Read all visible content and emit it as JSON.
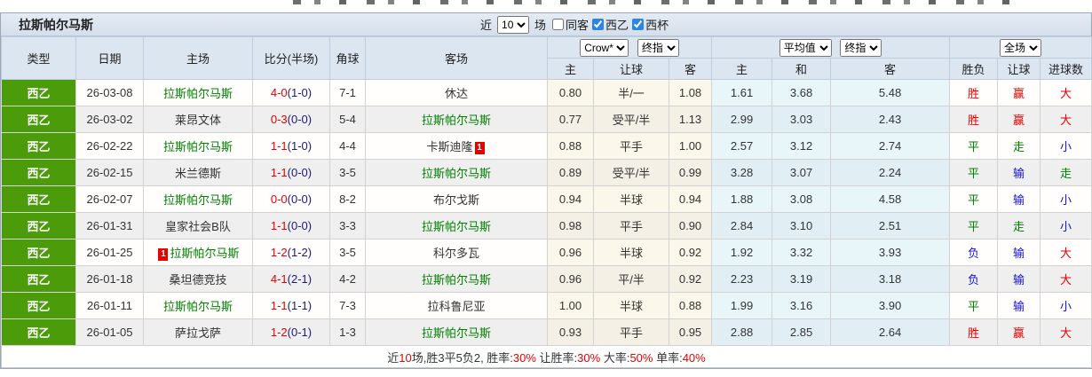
{
  "widget": {
    "title": "拉斯帕尔马斯",
    "filters": {
      "recent_label": "近",
      "recent_value": "10",
      "recent_suffix": "场",
      "checkboxes": [
        {
          "label": "同客",
          "checked": false
        },
        {
          "label": "西乙",
          "checked": true
        },
        {
          "label": "西杯",
          "checked": true
        }
      ]
    },
    "colors": {
      "league_green": "#4b9b0a",
      "team_self_green": "#008000",
      "score_red": "#e60000",
      "halftime_navy": "#1b1b7a",
      "result_red": "#e60000",
      "result_green": "#008000",
      "result_blue": "#1414cc",
      "header_bg": "#dce6f0",
      "checkbox_blue": "#2b85e4"
    },
    "table": {
      "left_headers": [
        "类型",
        "日期",
        "主场",
        "比分(半场)",
        "角球",
        "客场"
      ],
      "selectors": {
        "odds_source": "Crow*",
        "odds_stage_1": "终指",
        "avg_source": "平均值",
        "odds_stage_2": "终指",
        "scope": "全场"
      },
      "sub_headers": [
        "主",
        "让球",
        "客",
        "主",
        "和",
        "客",
        "胜负",
        "让球",
        "进球数"
      ],
      "rows": [
        {
          "league": "西乙",
          "date": "26-03-08",
          "home": {
            "name": "拉斯帕尔马斯",
            "self": true
          },
          "ft": "4-0",
          "ht": "(1-0)",
          "corner": "7-1",
          "away": {
            "name": "休达",
            "self": false
          },
          "crow": [
            "0.80",
            "半/一",
            "1.08"
          ],
          "avg": [
            "1.61",
            "3.68",
            "5.48"
          ],
          "results": [
            {
              "t": "胜",
              "c": "r"
            },
            {
              "t": "赢",
              "c": "r"
            },
            {
              "t": "大",
              "c": "r"
            }
          ]
        },
        {
          "league": "西乙",
          "date": "26-03-02",
          "home": {
            "name": "莱昂文体",
            "self": false
          },
          "ft": "0-3",
          "ht": "(0-0)",
          "corner": "5-4",
          "away": {
            "name": "拉斯帕尔马斯",
            "self": true
          },
          "crow": [
            "0.77",
            "受平/半",
            "1.13"
          ],
          "avg": [
            "2.99",
            "3.03",
            "2.43"
          ],
          "results": [
            {
              "t": "胜",
              "c": "r"
            },
            {
              "t": "赢",
              "c": "r"
            },
            {
              "t": "大",
              "c": "r"
            }
          ]
        },
        {
          "league": "西乙",
          "date": "26-02-22",
          "home": {
            "name": "拉斯帕尔马斯",
            "self": true
          },
          "ft": "1-1",
          "ht": "(1-0)",
          "corner": "4-4",
          "away": {
            "name": "卡斯迪隆",
            "self": false,
            "badge": "1",
            "badge_pos": "after"
          },
          "crow": [
            "0.88",
            "平手",
            "1.00"
          ],
          "avg": [
            "2.57",
            "3.12",
            "2.74"
          ],
          "results": [
            {
              "t": "平",
              "c": "g"
            },
            {
              "t": "走",
              "c": "g"
            },
            {
              "t": "小",
              "c": "b"
            }
          ]
        },
        {
          "league": "西乙",
          "date": "26-02-15",
          "home": {
            "name": "米兰德斯",
            "self": false
          },
          "ft": "1-1",
          "ht": "(0-0)",
          "corner": "3-5",
          "away": {
            "name": "拉斯帕尔马斯",
            "self": true
          },
          "crow": [
            "0.89",
            "受平/半",
            "0.99"
          ],
          "avg": [
            "3.28",
            "3.07",
            "2.24"
          ],
          "results": [
            {
              "t": "平",
              "c": "g"
            },
            {
              "t": "输",
              "c": "b"
            },
            {
              "t": "走",
              "c": "g"
            }
          ]
        },
        {
          "league": "西乙",
          "date": "26-02-07",
          "home": {
            "name": "拉斯帕尔马斯",
            "self": true
          },
          "ft": "0-0",
          "ht": "(0-0)",
          "corner": "8-2",
          "away": {
            "name": "布尔戈斯",
            "self": false
          },
          "crow": [
            "0.94",
            "半球",
            "0.94"
          ],
          "avg": [
            "1.88",
            "3.08",
            "4.58"
          ],
          "results": [
            {
              "t": "平",
              "c": "g"
            },
            {
              "t": "输",
              "c": "b"
            },
            {
              "t": "小",
              "c": "b"
            }
          ]
        },
        {
          "league": "西乙",
          "date": "26-01-31",
          "home": {
            "name": "皇家社会B队",
            "self": false
          },
          "ft": "1-1",
          "ht": "(0-0)",
          "corner": "3-3",
          "away": {
            "name": "拉斯帕尔马斯",
            "self": true
          },
          "crow": [
            "0.98",
            "平手",
            "0.90"
          ],
          "avg": [
            "2.84",
            "3.10",
            "2.51"
          ],
          "results": [
            {
              "t": "平",
              "c": "g"
            },
            {
              "t": "走",
              "c": "g"
            },
            {
              "t": "小",
              "c": "b"
            }
          ]
        },
        {
          "league": "西乙",
          "date": "26-01-25",
          "home": {
            "name": "拉斯帕尔马斯",
            "self": true,
            "badge": "1",
            "badge_pos": "before"
          },
          "ft": "1-2",
          "ht": "(1-2)",
          "corner": "3-5",
          "away": {
            "name": "科尔多瓦",
            "self": false
          },
          "crow": [
            "0.96",
            "半球",
            "0.92"
          ],
          "avg": [
            "1.92",
            "3.32",
            "3.93"
          ],
          "results": [
            {
              "t": "负",
              "c": "b"
            },
            {
              "t": "输",
              "c": "b"
            },
            {
              "t": "大",
              "c": "r"
            }
          ]
        },
        {
          "league": "西乙",
          "date": "26-01-18",
          "home": {
            "name": "桑坦德竞技",
            "self": false
          },
          "ft": "4-1",
          "ht": "(2-1)",
          "corner": "4-2",
          "away": {
            "name": "拉斯帕尔马斯",
            "self": true
          },
          "crow": [
            "0.96",
            "平/半",
            "0.92"
          ],
          "avg": [
            "2.23",
            "3.19",
            "3.18"
          ],
          "results": [
            {
              "t": "负",
              "c": "b"
            },
            {
              "t": "输",
              "c": "b"
            },
            {
              "t": "大",
              "c": "r"
            }
          ]
        },
        {
          "league": "西乙",
          "date": "26-01-11",
          "home": {
            "name": "拉斯帕尔马斯",
            "self": true
          },
          "ft": "1-1",
          "ht": "(1-1)",
          "corner": "7-3",
          "away": {
            "name": "拉科鲁尼亚",
            "self": false
          },
          "crow": [
            "1.00",
            "半球",
            "0.88"
          ],
          "avg": [
            "1.99",
            "3.16",
            "3.90"
          ],
          "results": [
            {
              "t": "平",
              "c": "g"
            },
            {
              "t": "输",
              "c": "b"
            },
            {
              "t": "小",
              "c": "b"
            }
          ]
        },
        {
          "league": "西乙",
          "date": "26-01-05",
          "home": {
            "name": "萨拉戈萨",
            "self": false
          },
          "ft": "1-2",
          "ht": "(0-1)",
          "corner": "1-3",
          "away": {
            "name": "拉斯帕尔马斯",
            "self": true
          },
          "crow": [
            "0.93",
            "平手",
            "0.95"
          ],
          "avg": [
            "2.88",
            "2.85",
            "2.64"
          ],
          "results": [
            {
              "t": "胜",
              "c": "r"
            },
            {
              "t": "赢",
              "c": "r"
            },
            {
              "t": "大",
              "c": "r"
            }
          ]
        }
      ]
    },
    "footer_segments": [
      {
        "text": "近",
        "red": false
      },
      {
        "text": "10",
        "red": true
      },
      {
        "text": "场,胜3平5负2, 胜率:",
        "red": false
      },
      {
        "text": "30%",
        "red": true
      },
      {
        "text": " 让胜率:",
        "red": false
      },
      {
        "text": "30%",
        "red": true
      },
      {
        "text": " 大率:",
        "red": false
      },
      {
        "text": "50%",
        "red": true
      },
      {
        "text": " 单率:",
        "red": false
      },
      {
        "text": "40%",
        "red": true
      }
    ]
  }
}
